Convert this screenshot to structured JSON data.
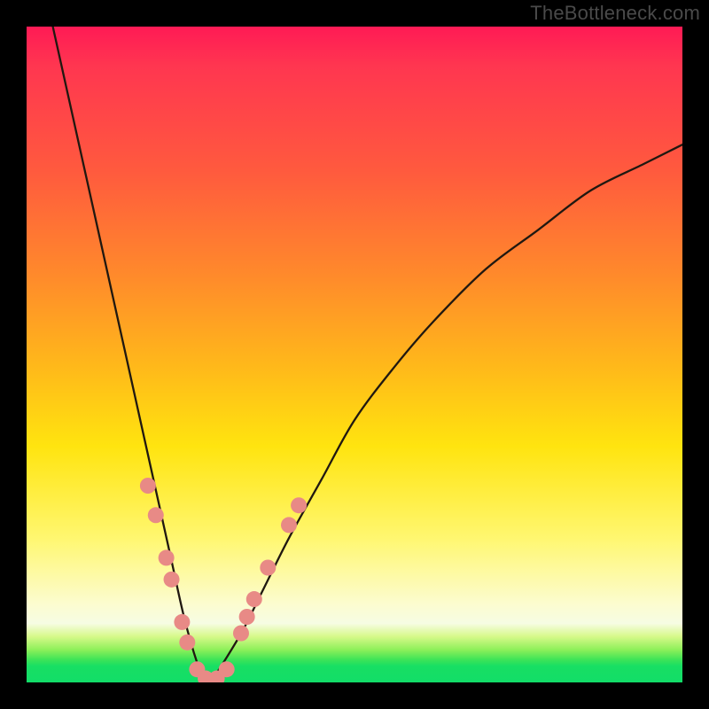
{
  "watermark": "TheBottleneck.com",
  "chart_data": {
    "type": "line",
    "title": "",
    "xlabel": "",
    "ylabel": "",
    "xlim": [
      0,
      100
    ],
    "ylim": [
      0,
      100
    ],
    "grid": false,
    "legend": false,
    "gradient_stops": [
      {
        "pos": 0,
        "color": "#ff1a55"
      },
      {
        "pos": 0.22,
        "color": "#ff5a3e"
      },
      {
        "pos": 0.52,
        "color": "#ffb91a"
      },
      {
        "pos": 0.78,
        "color": "#fff770"
      },
      {
        "pos": 0.91,
        "color": "#f6fce3"
      },
      {
        "pos": 0.97,
        "color": "#18df63"
      },
      {
        "pos": 1.0,
        "color": "#12dd68"
      }
    ],
    "series": [
      {
        "name": "left-branch",
        "color": "#201810",
        "stroke_width": 2.3,
        "x": [
          4,
          6,
          8,
          10,
          12,
          14,
          16,
          18,
          20,
          22,
          24,
          26,
          27,
          28
        ],
        "y": [
          100,
          91,
          82,
          73,
          64,
          55,
          46,
          37,
          28,
          19,
          10,
          3,
          1,
          0
        ]
      },
      {
        "name": "right-branch",
        "color": "#201810",
        "stroke_width": 2.3,
        "x": [
          28,
          30,
          33,
          36,
          40,
          45,
          50,
          56,
          62,
          70,
          78,
          86,
          94,
          100
        ],
        "y": [
          0,
          3,
          8,
          14,
          22,
          31,
          40,
          48,
          55,
          63,
          69,
          75,
          79,
          82
        ]
      }
    ],
    "scatter": {
      "name": "dots",
      "color": "#e88a86",
      "radius": 9,
      "points": [
        {
          "x": 18.5,
          "y": 30.0
        },
        {
          "x": 19.7,
          "y": 25.5
        },
        {
          "x": 21.3,
          "y": 19.0
        },
        {
          "x": 22.1,
          "y": 15.7
        },
        {
          "x": 23.7,
          "y": 9.2
        },
        {
          "x": 24.5,
          "y": 6.1
        },
        {
          "x": 26.0,
          "y": 2.0
        },
        {
          "x": 27.3,
          "y": 0.6
        },
        {
          "x": 29.0,
          "y": 0.6
        },
        {
          "x": 30.5,
          "y": 2.0
        },
        {
          "x": 32.7,
          "y": 7.5
        },
        {
          "x": 33.6,
          "y": 10.0
        },
        {
          "x": 34.7,
          "y": 12.7
        },
        {
          "x": 36.8,
          "y": 17.5
        },
        {
          "x": 40.0,
          "y": 24.0
        },
        {
          "x": 41.5,
          "y": 27.0
        }
      ]
    }
  }
}
